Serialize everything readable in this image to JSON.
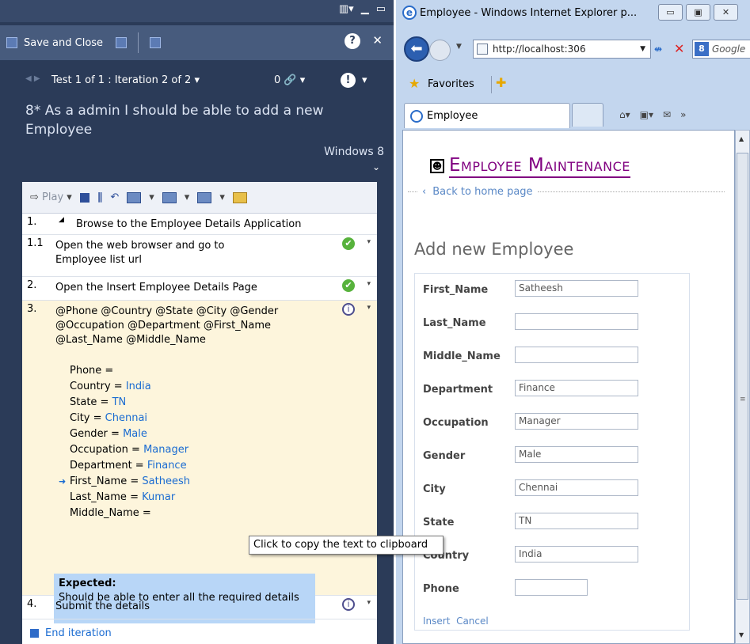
{
  "mtm": {
    "toolbar": {
      "save_close": "Save and Close"
    },
    "iteration": {
      "label": "Test 1 of 1 : Iteration 2 of 2",
      "attach_count": "0"
    },
    "title": "8* As a admin I should be able to add a new Employee",
    "config": "Windows 8",
    "playbar": {
      "play": "Play"
    },
    "steps": [
      {
        "num": "1.",
        "text": "Browse to the Employee Details Application",
        "status": ""
      },
      {
        "num": "1.1",
        "text": "Open the web browser and go to Employee list url",
        "status": "pass"
      },
      {
        "num": "2.",
        "text": "Open the Insert Employee Details Page",
        "status": "pass"
      },
      {
        "num": "3.",
        "text": "@Phone @Country @State @City @Gender @Occupation @Department @First_Name @Last_Name @Middle_Name",
        "status": "none"
      },
      {
        "num": "4.",
        "text": "Submit the details",
        "status": "none"
      }
    ],
    "params": [
      {
        "name": "Phone =",
        "value": ""
      },
      {
        "name": "Country =",
        "value": "India"
      },
      {
        "name": "State =",
        "value": "TN"
      },
      {
        "name": "City =",
        "value": "Chennai"
      },
      {
        "name": "Gender =",
        "value": "Male"
      },
      {
        "name": "Occupation =",
        "value": "Manager"
      },
      {
        "name": "Department =",
        "value": "Finance"
      },
      {
        "name": "First_Name =",
        "value": "Satheesh",
        "current": true
      },
      {
        "name": "Last_Name =",
        "value": "Kumar"
      },
      {
        "name": "Middle_Name =",
        "value": ""
      }
    ],
    "expected": {
      "label": "Expected:",
      "text": "Should be able to enter all the required details"
    },
    "tooltip": "Click to copy the text to clipboard",
    "end_iteration": "End iteration"
  },
  "ie": {
    "window_title": "Employee - Windows Internet Explorer p...",
    "address": "http://localhost:306",
    "search_placeholder": "Google",
    "favorites": "Favorites",
    "tab_label": "Employee",
    "page": {
      "title": "Employee Maintenance",
      "back_link": "Back to home page",
      "heading": "Add new Employee",
      "fields": [
        {
          "label": "First_Name",
          "value": "Satheesh"
        },
        {
          "label": "Last_Name",
          "value": ""
        },
        {
          "label": "Middle_Name",
          "value": ""
        },
        {
          "label": "Department",
          "value": "Finance"
        },
        {
          "label": "Occupation",
          "value": "Manager"
        },
        {
          "label": "Gender",
          "value": "Male"
        },
        {
          "label": "City",
          "value": "Chennai"
        },
        {
          "label": "State",
          "value": "TN"
        },
        {
          "label": "Country",
          "value": "India"
        },
        {
          "label": "Phone",
          "value": ""
        }
      ],
      "insert": "Insert",
      "cancel": "Cancel"
    }
  },
  "colors": {
    "mtm_bg": "#2b3b58",
    "link_blue": "#1a6bd1",
    "title_purple": "#800080",
    "expected_bg": "#b8d6f7",
    "step_highlight": "#fdf5dc"
  }
}
